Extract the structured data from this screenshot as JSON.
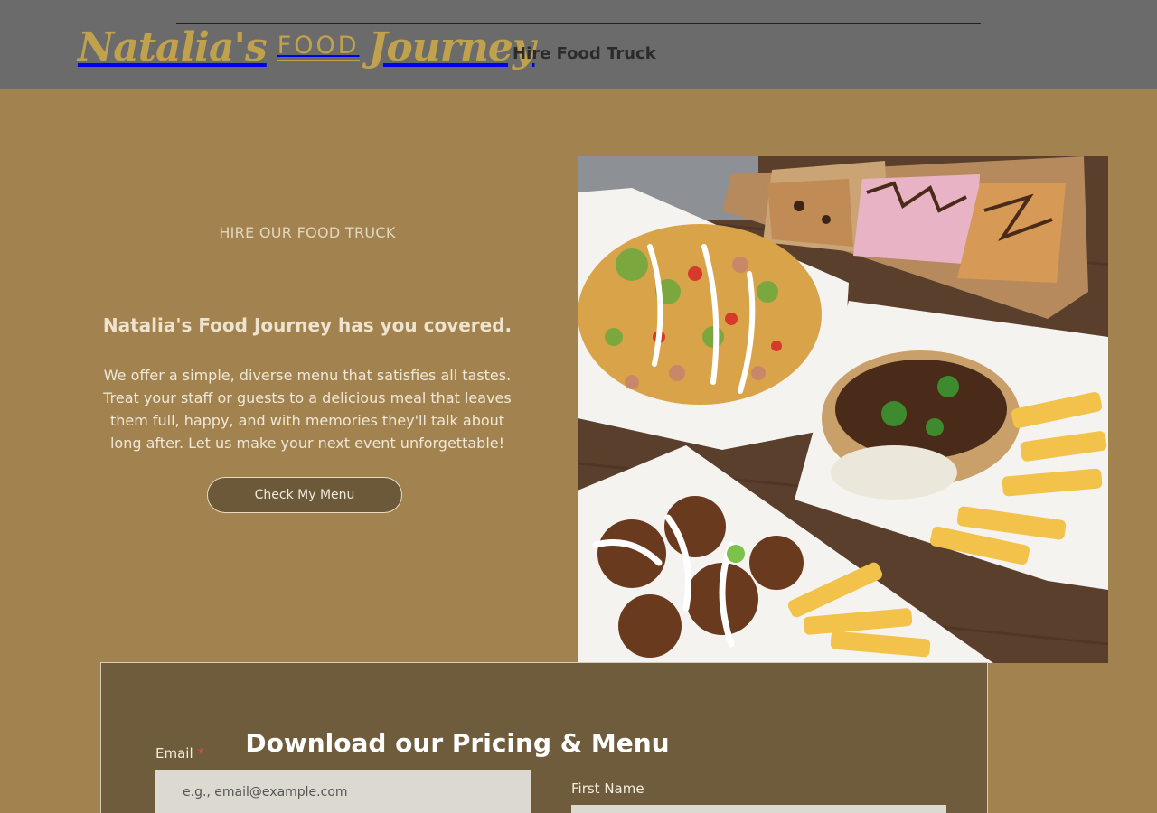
{
  "header": {
    "logo": {
      "first": "Natalia's",
      "middle": "FOOD",
      "last": "Journey"
    },
    "nav": [
      {
        "label": "Hire Food Truck"
      }
    ]
  },
  "hero": {
    "eyebrow": "HIRE OUR FOOD TRUCK",
    "title": "Natalia's Food Journey has you covered.",
    "body": "We offer a simple, diverse menu that satisfies all tastes. Treat your staff or guests to a delicious meal that leaves them full, happy, and with memories they'll talk about long after. Let us make your next event unforgettable!",
    "cta_label": "Check My Menu",
    "image_alt": "Food truck dishes: loaded nachos, pulled meat burger with fries, glazed chicken with fries, dessert bars"
  },
  "form": {
    "title": "Download our Pricing & Menu",
    "email_label": "Email",
    "email_required_mark": "*",
    "email_placeholder": "e.g., email@example.com",
    "first_name_label": "First Name"
  },
  "colors": {
    "header_bg": "#6b6b6b",
    "page_bg": "#a28350",
    "logo_gold": "#c0a14e",
    "panel_bg": "#6f5c3c",
    "button_bg": "#6b5939"
  }
}
